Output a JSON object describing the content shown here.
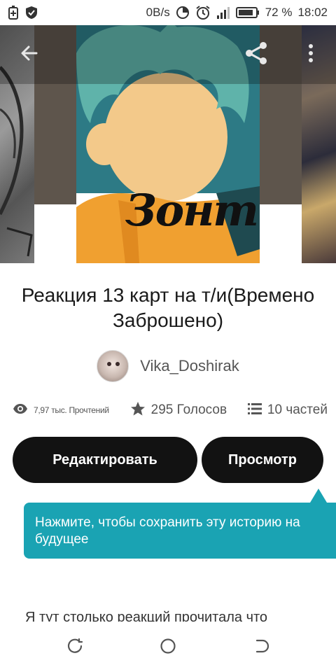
{
  "status_bar": {
    "net_speed": "0B/s",
    "battery": "72 %",
    "time": "18:02"
  },
  "icons": {
    "back": "arrow-left-icon",
    "share": "share-icon",
    "more": "more-vertical-icon",
    "views": "eye-icon",
    "votes": "star-icon",
    "parts": "list-icon"
  },
  "cover": {
    "title_art": "Зонти"
  },
  "story": {
    "title": "Реакция 13 карт на т/и(Времено Заброшено)",
    "author": "Vika_Doshirak"
  },
  "stats": {
    "reads": "7,97 тыс. Прочтений",
    "votes": "295 Голосов",
    "parts": "10 частей"
  },
  "actions": {
    "edit_label": "Редактировать",
    "preview_label": "Просмотр"
  },
  "tooltip": {
    "text": "Нажмите, чтобы сохранить эту историю на будущее"
  },
  "description": {
    "text": "Я тут столько реакций прочитала что"
  },
  "colors": {
    "accent_tooltip": "#1aa3b3",
    "button_bg": "#121212",
    "button_text": "#ffffff"
  }
}
